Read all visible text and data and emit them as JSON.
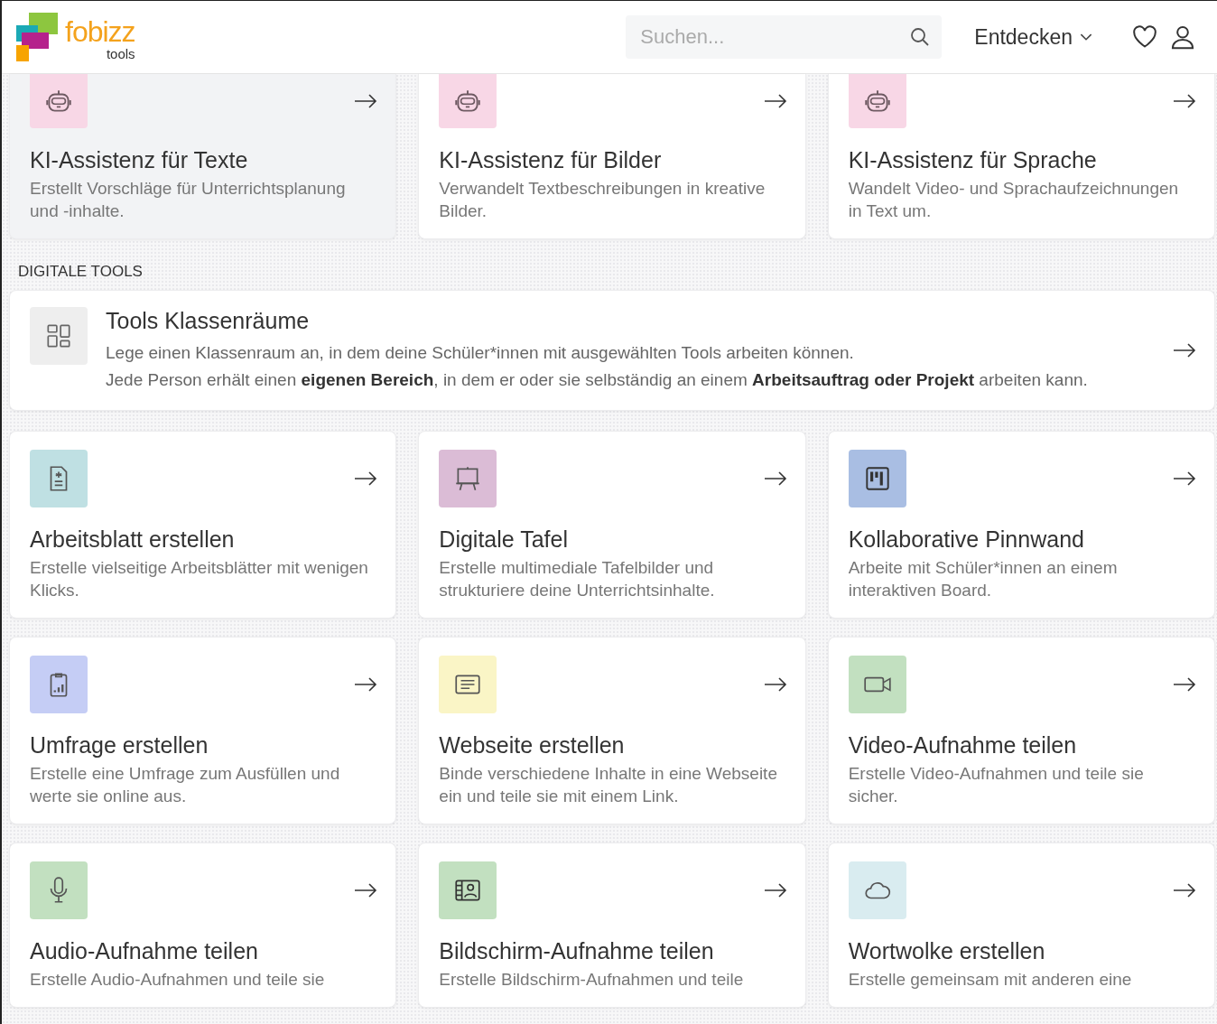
{
  "header": {
    "logo": {
      "name": "fobizz",
      "sub": "tools"
    },
    "search": {
      "placeholder": "Suchen..."
    },
    "menu": "Entdecken"
  },
  "ai_tools": [
    {
      "title": "KI-Assistenz für Texte",
      "description": "Erstellt Vorschläge für Unterrichtsplanung und -inhalte.",
      "kind": "robot",
      "color": "#f8d7e6",
      "hovered": true
    },
    {
      "title": "KI-Assistenz für Bilder",
      "description": "Verwandelt Textbeschreibungen in kreative Bilder.",
      "kind": "robot",
      "color": "#f8d7e6",
      "hovered": false
    },
    {
      "title": "KI-Assistenz für Sprache",
      "description": "Wandelt Video- und Sprachaufzeichnungen in Text um.",
      "kind": "robot",
      "color": "#f8d7e6",
      "hovered": false
    }
  ],
  "section_title": "DIGITALE TOOLS",
  "classroom": {
    "title": "Tools Klassenräume",
    "lines": [
      "Lege einen Klassenraum an, in dem deine Schüler*innen mit ausgewählten Tools arbeiten können.",
      "Jede Person erhält einen **eigenen Bereich**, in dem er oder sie selbständig an einem **Arbeitsauftrag oder Projekt** arbeiten kann."
    ]
  },
  "tools": [
    {
      "title": "Arbeitsblatt erstellen",
      "description": "Erstelle vielseitige Arbeitsblätter mit wenigen Klicks.",
      "kind": "document",
      "color": "#bfe0e3"
    },
    {
      "title": "Digitale Tafel",
      "description": "Erstelle multimediale Tafelbilder und strukturiere deine Unterrichtsinhalte.",
      "kind": "easel",
      "color": "#dbbcd6"
    },
    {
      "title": "Kollaborative Pinnwand",
      "description": "Arbeite mit Schüler*innen an einem interaktiven Board.",
      "kind": "board",
      "color": "#a9bee3"
    },
    {
      "title": "Umfrage erstellen",
      "description": "Erstelle eine Umfrage zum Ausfüllen und werte sie online aus.",
      "kind": "poll",
      "color": "#c5cdf5"
    },
    {
      "title": "Webseite erstellen",
      "description": "Binde verschiedene Inhalte in eine Webseite ein und teile sie mit einem Link.",
      "kind": "page",
      "color": "#faf5c6"
    },
    {
      "title": "Video-Aufnahme teilen",
      "description": "Erstelle Video-Aufnahmen und teile sie sicher.",
      "kind": "video",
      "color": "#c2e0c0"
    },
    {
      "title": "Audio-Aufnahme teilen",
      "description": "Erstelle Audio-Aufnahmen und teile sie",
      "kind": "mic",
      "color": "#c2e0c0"
    },
    {
      "title": "Bildschirm-Aufnahme teilen",
      "description": "Erstelle Bildschirm-Aufnahmen und teile",
      "kind": "screen",
      "color": "#c2e0c0"
    },
    {
      "title": "Wortwolke erstellen",
      "description": "Erstelle gemeinsam mit anderen eine",
      "kind": "cloud",
      "color": "#d9ecf0"
    }
  ]
}
